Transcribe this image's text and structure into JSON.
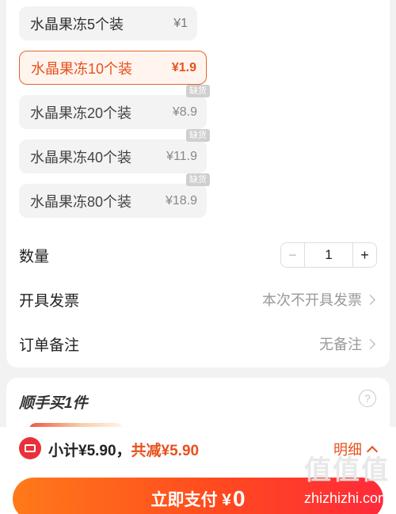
{
  "skus": [
    {
      "label": "水晶果冻5个装",
      "price": "¥1",
      "state": "normal",
      "badge": ""
    },
    {
      "label": "水晶果冻10个装",
      "price": "¥1.9",
      "state": "selected",
      "badge": ""
    },
    {
      "label": "水晶果冻20个装",
      "price": "¥8.9",
      "state": "out",
      "badge": "缺货"
    },
    {
      "label": "水晶果冻40个装",
      "price": "¥11.9",
      "state": "out",
      "badge": "缺货"
    },
    {
      "label": "水晶果冻80个装",
      "price": "¥18.9",
      "state": "out",
      "badge": "缺货"
    }
  ],
  "quantity": {
    "label": "数量",
    "minus": "−",
    "value": "1",
    "plus": "+"
  },
  "invoice": {
    "label": "开具发票",
    "value": "本次不开具发票"
  },
  "remark": {
    "label": "订单备注",
    "value": "无备注"
  },
  "addon": {
    "title": "顺手买1件",
    "help": "?"
  },
  "footer": {
    "subtotal": "小计¥5.90，",
    "reduction": "共减¥5.90",
    "detail": "明细",
    "pay_label": "立即支付 ¥",
    "pay_amount": "0"
  },
  "watermark": {
    "logo": "值值值",
    "url": "zhizhizhi.com"
  },
  "colors": {
    "accent": "#e8501c",
    "pay_start": "#ff7a1a",
    "pay_end": "#ff2a3a",
    "badge": "#cfcfcf"
  }
}
